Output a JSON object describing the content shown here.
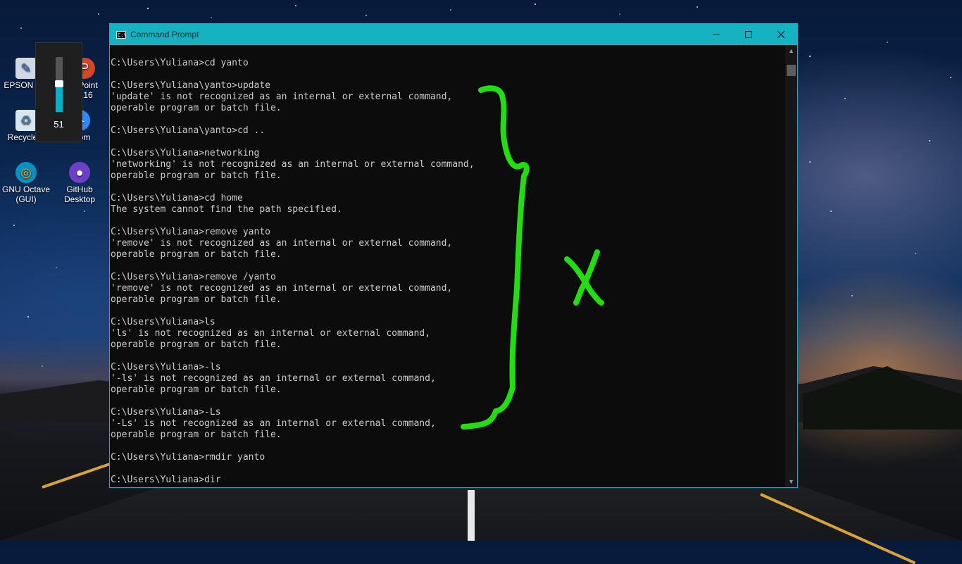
{
  "window": {
    "title": "Command Prompt",
    "controls": {
      "minimize": "–",
      "maximize": "☐",
      "close": "✕"
    }
  },
  "volume": {
    "level": 51,
    "level_label": "51"
  },
  "desktop_icons": [
    {
      "label": "EPSON S...",
      "icon": "epson-scan-icon"
    },
    {
      "label": "...Point ...16",
      "icon": "powerpoint-icon"
    },
    {
      "label": "Recycle...",
      "icon": "recycle-bin-icon"
    },
    {
      "label": "Zoom",
      "icon": "zoom-icon"
    },
    {
      "label": "GNU Octave (GUI)",
      "icon": "octave-icon"
    },
    {
      "label": "GitHub Desktop",
      "icon": "github-icon"
    }
  ],
  "console_lines": [
    "C:\\Users\\Yuliana>cd yanto",
    "",
    "C:\\Users\\Yuliana\\yanto>update",
    "'update' is not recognized as an internal or external command,",
    "operable program or batch file.",
    "",
    "C:\\Users\\Yuliana\\yanto>cd ..",
    "",
    "C:\\Users\\Yuliana>networking",
    "'networking' is not recognized as an internal or external command,",
    "operable program or batch file.",
    "",
    "C:\\Users\\Yuliana>cd home",
    "The system cannot find the path specified.",
    "",
    "C:\\Users\\Yuliana>remove yanto",
    "'remove' is not recognized as an internal or external command,",
    "operable program or batch file.",
    "",
    "C:\\Users\\Yuliana>remove /yanto",
    "'remove' is not recognized as an internal or external command,",
    "operable program or batch file.",
    "",
    "C:\\Users\\Yuliana>ls",
    "'ls' is not recognized as an internal or external command,",
    "operable program or batch file.",
    "",
    "C:\\Users\\Yuliana>-ls",
    "'-ls' is not recognized as an internal or external command,",
    "operable program or batch file.",
    "",
    "C:\\Users\\Yuliana>-Ls",
    "'-Ls' is not recognized as an internal or external command,",
    "operable program or batch file.",
    "",
    "C:\\Users\\Yuliana>rmdir yanto",
    "",
    "C:\\Users\\Yuliana>dir"
  ],
  "colors": {
    "titlebar": "#17b2c2",
    "console_bg": "#0c0c0c",
    "console_text": "#cccccc",
    "annotation": "#22dd11"
  }
}
